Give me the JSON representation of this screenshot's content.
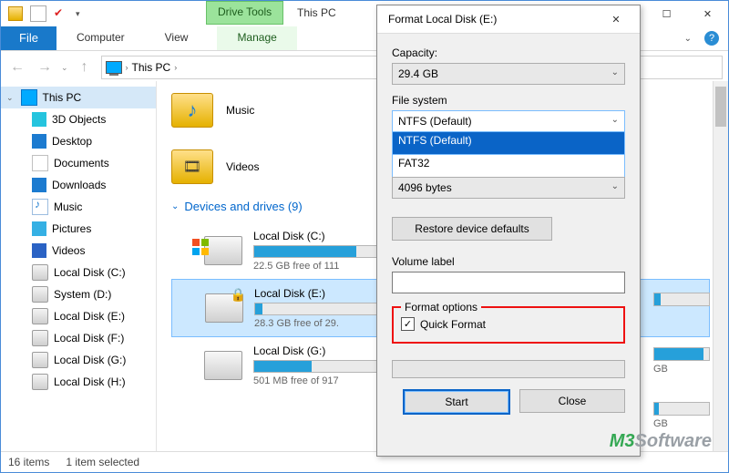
{
  "window": {
    "title": "This PC",
    "qat_caret_label": "▾",
    "contextual_tab": "Drive Tools",
    "controls": {
      "min": "—",
      "max": "☐",
      "close": "✕"
    }
  },
  "ribbon": {
    "file": "File",
    "tabs": [
      "Computer",
      "View"
    ],
    "manage": "Manage",
    "help_glyph": "?"
  },
  "breadcrumb": {
    "back": "←",
    "forward": "→",
    "up": "↑",
    "segments": [
      "This PC"
    ],
    "sep": "›",
    "refresh": "↻"
  },
  "tree": {
    "root": "This PC",
    "items": [
      {
        "label": "3D Objects",
        "icon": "cyan"
      },
      {
        "label": "Desktop",
        "icon": "blue"
      },
      {
        "label": "Documents",
        "icon": "white"
      },
      {
        "label": "Downloads",
        "icon": "blue"
      },
      {
        "label": "Music",
        "icon": "note"
      },
      {
        "label": "Pictures",
        "icon": "pic"
      },
      {
        "label": "Videos",
        "icon": "film"
      },
      {
        "label": "Local Disk (C:)",
        "icon": "disk"
      },
      {
        "label": "System (D:)",
        "icon": "disk"
      },
      {
        "label": "Local Disk (E:)",
        "icon": "disk"
      },
      {
        "label": "Local Disk (F:)",
        "icon": "disk"
      },
      {
        "label": "Local Disk (G:)",
        "icon": "disk"
      },
      {
        "label": "Local Disk (H:)",
        "icon": "disk"
      }
    ]
  },
  "content": {
    "folders": [
      {
        "label": "Music",
        "glyph": "♪"
      },
      {
        "label": "Videos",
        "glyph": "🎞"
      }
    ],
    "section_header": "Devices and drives (9)",
    "drives": [
      {
        "name": "Local Disk (C:)",
        "free": "22.5 GB free of 111",
        "fill": 80,
        "win": true
      },
      {
        "name": "Local Disk (E:)",
        "free": "28.3 GB free of 29.",
        "fill": 6,
        "lock": true,
        "selected": true
      },
      {
        "name": "Local Disk (G:)",
        "free": "501 MB free of 917",
        "fill": 45
      }
    ],
    "peek": [
      {
        "fill": 12,
        "suffix": "",
        "label": ""
      },
      {
        "fill": 90,
        "suffix": "GB",
        "label": ""
      },
      {
        "fill": 8,
        "suffix": "GB",
        "label": ""
      }
    ]
  },
  "statusbar": {
    "count": "16 items",
    "selection": "1 item selected"
  },
  "dialog": {
    "title": "Format Local Disk (E:)",
    "close_glyph": "✕",
    "capacity_label": "Capacity:",
    "capacity_value": "29.4 GB",
    "filesystem_label": "File system",
    "filesystem_value": "NTFS (Default)",
    "filesystem_options": [
      "NTFS (Default)",
      "FAT32"
    ],
    "alloc_value": "4096 bytes",
    "restore_btn": "Restore device defaults",
    "volume_label": "Volume label",
    "volume_value": "",
    "format_options_label": "Format options",
    "quick_format_label": "Quick Format",
    "quick_format_checked": true,
    "start_btn": "Start",
    "close_btn": "Close"
  },
  "logo": {
    "m": "M",
    "three": "3",
    "rest": "Software"
  }
}
